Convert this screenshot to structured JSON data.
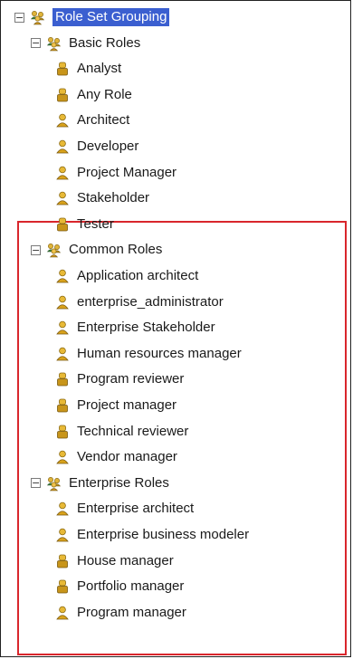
{
  "tree": {
    "root": {
      "label": "Role Set Grouping",
      "toggle": "−"
    },
    "groups": [
      {
        "label": "Basic Roles",
        "toggle": "−",
        "items": [
          {
            "label": "Analyst",
            "icon": "role-icon-alt"
          },
          {
            "label": "Any Role",
            "icon": "role-icon-alt"
          },
          {
            "label": "Architect",
            "icon": "role-icon"
          },
          {
            "label": "Developer",
            "icon": "role-icon"
          },
          {
            "label": "Project Manager",
            "icon": "role-icon"
          },
          {
            "label": "Stakeholder",
            "icon": "role-icon"
          },
          {
            "label": "Tester",
            "icon": "role-icon-alt"
          }
        ]
      },
      {
        "label": "Common Roles",
        "toggle": "−",
        "items": [
          {
            "label": "Application architect",
            "icon": "role-icon"
          },
          {
            "label": "enterprise_administrator",
            "icon": "role-icon"
          },
          {
            "label": "Enterprise Stakeholder",
            "icon": "role-icon"
          },
          {
            "label": "Human resources manager",
            "icon": "role-icon"
          },
          {
            "label": "Program reviewer",
            "icon": "role-icon-alt"
          },
          {
            "label": "Project manager",
            "icon": "role-icon-alt"
          },
          {
            "label": "Technical reviewer",
            "icon": "role-icon-alt"
          },
          {
            "label": "Vendor manager",
            "icon": "role-icon"
          }
        ]
      },
      {
        "label": "Enterprise Roles",
        "toggle": "−",
        "items": [
          {
            "label": "Enterprise architect",
            "icon": "role-icon"
          },
          {
            "label": "Enterprise business modeler",
            "icon": "role-icon"
          },
          {
            "label": "House manager",
            "icon": "role-icon-alt"
          },
          {
            "label": "Portfolio manager",
            "icon": "role-icon-alt"
          },
          {
            "label": "Program manager",
            "icon": "role-icon"
          }
        ]
      }
    ]
  },
  "colors": {
    "selection": "#3b5fd0",
    "highlight_border": "#d9262c",
    "icon_gold": "#d9a21b"
  }
}
